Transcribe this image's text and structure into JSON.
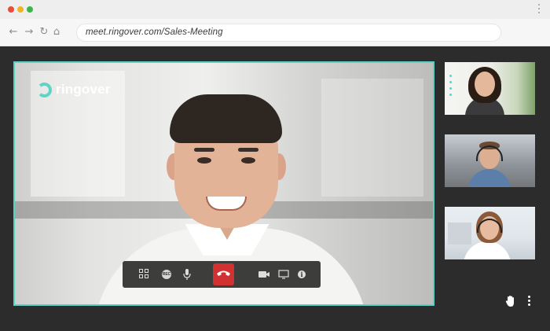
{
  "browser": {
    "url": "meet.ringover.com/Sales-Meeting",
    "nav": {
      "back": "←",
      "forward": "→",
      "reload": "↻",
      "home": "⌂"
    }
  },
  "meeting": {
    "brand": "ringover",
    "accent_color": "#59d2c5",
    "hangup_color": "#d13131",
    "controls": [
      {
        "name": "grid-view-icon"
      },
      {
        "name": "record-icon",
        "text": "REC"
      },
      {
        "name": "microphone-icon"
      },
      {
        "name": "hang-up-icon"
      },
      {
        "name": "camera-icon"
      },
      {
        "name": "screen-share-icon"
      },
      {
        "name": "info-icon",
        "text": "i"
      }
    ],
    "participants": [
      {
        "name": "participant-thumbnail-1"
      },
      {
        "name": "participant-thumbnail-2"
      },
      {
        "name": "participant-thumbnail-3"
      }
    ],
    "actions": [
      "raise-hand-icon",
      "more-options-icon"
    ]
  }
}
